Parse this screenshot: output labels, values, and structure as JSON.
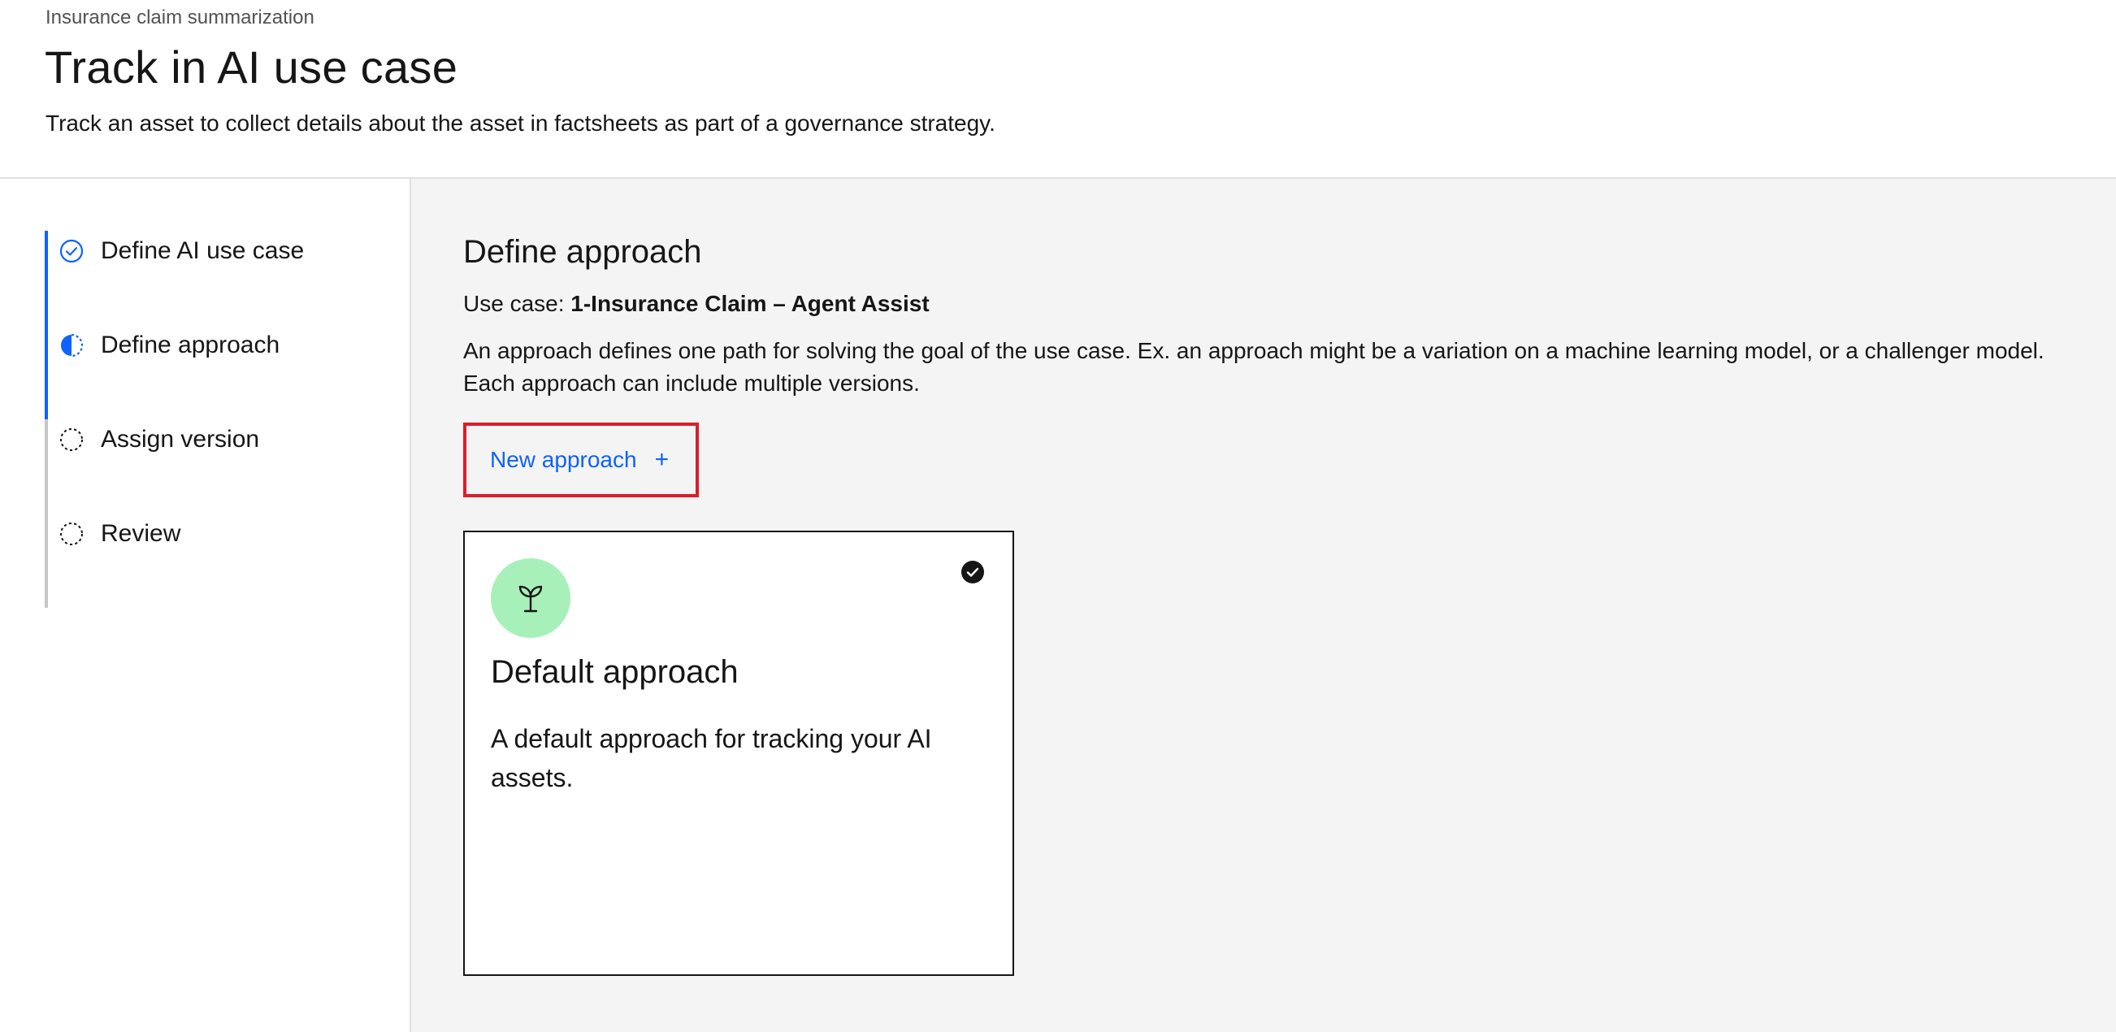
{
  "header": {
    "breadcrumb": "Insurance claim summarization",
    "title": "Track in AI use case",
    "subtitle": "Track an asset to collect details about the asset in factsheets as part of a governance strategy."
  },
  "sidebar": {
    "steps": [
      {
        "label": "Define AI use case",
        "status": "complete",
        "icon": "checkmark-circle-icon"
      },
      {
        "label": "Define approach",
        "status": "current",
        "icon": "half-circle-icon"
      },
      {
        "label": "Assign version",
        "status": "incomplete",
        "icon": "dashed-circle-icon"
      },
      {
        "label": "Review",
        "status": "incomplete",
        "icon": "dashed-circle-icon"
      }
    ]
  },
  "main": {
    "title": "Define approach",
    "use_case_label": "Use case:",
    "use_case_value": "1-Insurance Claim – Agent Assist",
    "description_line1": "An approach defines one path for solving the goal of the use case. Ex. an approach might be a variation on a machine learning model, or a challenger model.",
    "description_line2": "Each approach can include multiple versions.",
    "new_approach_label": "New approach",
    "new_approach_icon": "plus-icon",
    "card": {
      "title": "Default approach",
      "description": "A default approach for tracking your AI assets.",
      "icon": "sprout-icon",
      "selected": true
    }
  },
  "colors": {
    "accent": "#0f62fe",
    "highlight_border": "#da1e28",
    "avatar_bg": "#a7f0ba",
    "main_bg": "#f4f4f4"
  }
}
